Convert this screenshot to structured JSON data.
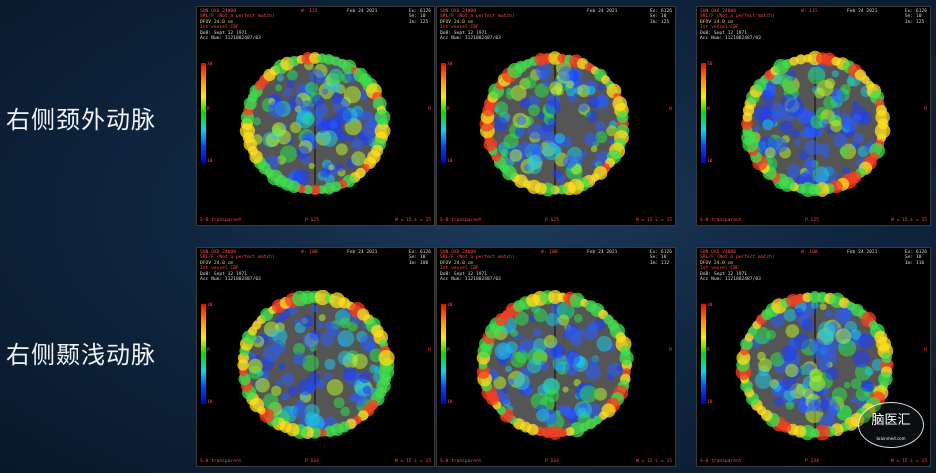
{
  "rows": [
    {
      "label": "右侧颈外动脉"
    },
    {
      "label": "右侧颞浅动脉"
    }
  ],
  "panels": [
    {
      "h1": "SUN OXO 24000",
      "h2": "SRL/F (Not a perfect match)",
      "h3": "DFOV 24.0 cm",
      "h4": "1st vessel CBF",
      "h5": "DoB: Sept 12 1971",
      "h6": "Acc Num: 1121882487/03",
      "mid": "W: 115",
      "date": "Feb 24 2021",
      "tr1": "Ex: 6126",
      "tr2": "Se: 10",
      "tr3": "Im: 125",
      "cb_top": "30",
      "cb_mid": "R",
      "cb_bot": "10",
      "rmark": "R",
      "ftr": "S-0 transparent",
      "fp": "P 125",
      "fw": "W = 15  L = 15"
    },
    {
      "h1": "SUN OXO 24000",
      "h2": "SRL/F (Not a perfect match)",
      "h3": "DFOV 24.0 cm",
      "h4": "1st vessel CBF",
      "h5": "DoB: Sept 12 1971",
      "h6": "Acc Num: 1121882487/03",
      "mid": "",
      "date": "Feb 24 2021",
      "tr1": "Ex: 6126",
      "tr2": "Se: 10",
      "tr3": "Im: 125",
      "cb_top": "30",
      "cb_mid": "R",
      "cb_bot": "10",
      "rmark": "R",
      "ftr": "S-0 transparent",
      "fp": "P 125",
      "fw": "W = 15  L = 15"
    },
    {
      "h1": "SUN OXO 24000",
      "h2": "SRL/F (Not a perfect match)",
      "h3": "DFOV 24.0 cm",
      "h4": "1st vessel CBF",
      "h5": "DoB: Sept 12 1971",
      "h6": "Acc Num: 1121882487/03",
      "mid": "W: 115",
      "date": "Feb 24 2021",
      "tr1": "Ex: 6126",
      "tr2": "Se: 10",
      "tr3": "Im: 125",
      "cb_top": "30",
      "cb_mid": "R",
      "cb_bot": "10",
      "rmark": "R",
      "ftr": "S-0 transparent",
      "fp": "P 125",
      "fw": "W = 15  L = 15"
    },
    {
      "h1": "SUN OXO 24000",
      "h2": "SRL/F (Not a perfect match)",
      "h3": "DFOV 24.0 cm",
      "h4": "1st vessel CBF",
      "h5": "DoB: Sept 12 1971",
      "h6": "Acc Num: 1121882487/03",
      "mid": "W: 100",
      "date": "Feb 24 2021",
      "tr1": "Ex: 6126",
      "tr2": "Se: 10",
      "tr3": "Im: 108",
      "cb_top": "30",
      "cb_mid": "R",
      "cb_bot": "10",
      "rmark": "R",
      "ftr": "S-0 transparent",
      "fp": "P 134",
      "fw": "W = 15  L = 15"
    },
    {
      "h1": "SUN OXO 24000",
      "h2": "SRL/F (Not a perfect match)",
      "h3": "DFOV 24.0 cm",
      "h4": "1st vessel CBF",
      "h5": "DoB: Sept 12 1971",
      "h6": "Acc Num: 1121882487/03",
      "mid": "W: 100",
      "date": "Feb 24 2021",
      "tr1": "Ex: 6126",
      "tr2": "Se: 10",
      "tr3": "Im: 112",
      "cb_top": "30",
      "cb_mid": "R",
      "cb_bot": "10",
      "rmark": "R",
      "ftr": "S-0 transparent",
      "fp": "P 134",
      "fw": "W = 15  L = 15"
    },
    {
      "h1": "SUN OXO 24000",
      "h2": "SRL/F (Not a perfect match)",
      "h3": "DFOV 24.0 cm",
      "h4": "1st vessel CBF",
      "h5": "DoB: Sept 12 1971",
      "h6": "Acc Num: 1121882487/03",
      "mid": "W: 100",
      "date": "Feb 24 2021",
      "tr1": "Ex: 6126",
      "tr2": "Se: 10",
      "tr3": "Im: 116",
      "cb_top": "30",
      "cb_mid": "R",
      "cb_bot": "10",
      "rmark": "R",
      "ftr": "S-0 transparent",
      "fp": "P 134",
      "fw": "W = 15  L = 15"
    }
  ],
  "watermark": {
    "text": "脑医汇",
    "sub": "brainmed.com"
  },
  "colors": {
    "background": "#0f2640",
    "label": "#f2f4f8",
    "overlay_red": "#ff4a4a",
    "overlay_yellow": "#e8d25a"
  }
}
